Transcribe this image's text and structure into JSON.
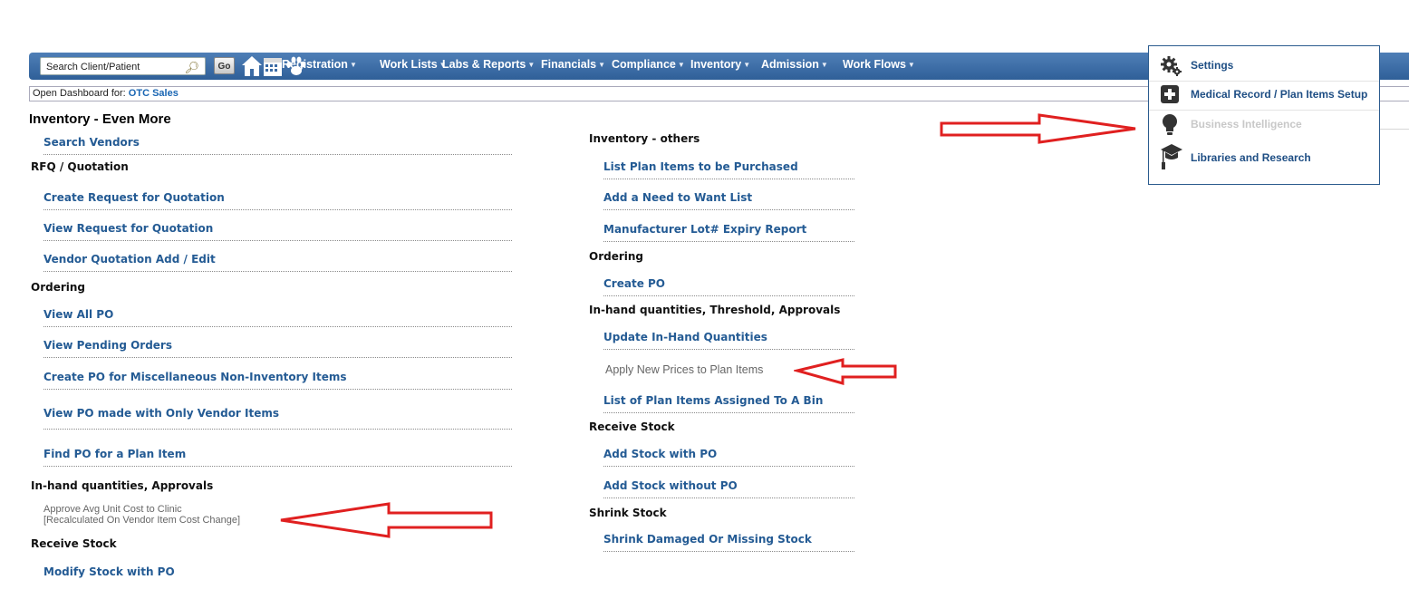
{
  "nav": {
    "search_placeholder": "Search Client/Patient",
    "go_label": "Go",
    "menus": [
      "Registration",
      "Work Lists",
      "Labs & Reports",
      "Financials",
      "Compliance",
      "Inventory",
      "Admission",
      "Work Flows"
    ]
  },
  "dashboard": {
    "prefix": "Open Dashboard for:",
    "link": "OTC Sales"
  },
  "page_title": "Inventory - Even More",
  "left_column": {
    "search_vendors": "Search Vendors",
    "rfq_header": "RFQ / Quotation",
    "create_rfq": "Create Request for Quotation",
    "view_rfq": "View Request for Quotation",
    "vendor_quote": "Vendor Quotation Add / Edit",
    "ordering_header": "Ordering",
    "view_all_po": "View All PO",
    "view_pending": "View Pending Orders",
    "create_po_misc": "Create PO for Miscellaneous Non-Inventory Items",
    "view_po_vendor": "View PO made with Only Vendor Items",
    "find_po": "Find PO for a Plan Item",
    "inhand_header": "In-hand quantities, Approvals",
    "approve_line1": "Approve Avg Unit Cost to Clinic",
    "approve_line2": "[Recalculated On Vendor Item Cost Change]",
    "receive_header": "Receive Stock",
    "modify_stock": "Modify Stock with PO"
  },
  "right_column": {
    "others_header": "Inventory - others",
    "list_plan_items": "List Plan Items to be Purchased",
    "add_need": "Add a Need to Want List",
    "mfr_lot": "Manufacturer Lot# Expiry Report",
    "ordering_header": "Ordering",
    "create_po": "Create PO",
    "inhand_header": "In-hand quantities, Threshold, Approvals",
    "update_inhand": "Update In-Hand Quantities",
    "apply_prices": "Apply New Prices to Plan Items",
    "list_bin": "List of Plan Items Assigned To A Bin",
    "receive_header": "Receive Stock",
    "add_stock_po": "Add Stock with PO",
    "add_stock_no_po": "Add Stock without PO",
    "shrink_header": "Shrink Stock",
    "shrink_damaged": "Shrink Damaged Or Missing Stock"
  },
  "popup": {
    "items": [
      {
        "label": "Settings",
        "icon": "gears-icon"
      },
      {
        "label": "Medical Record / Plan Items Setup",
        "icon": "medical-plus-icon"
      },
      {
        "label": "Business Intelligence",
        "icon": "lightbulb-icon"
      },
      {
        "label": "Libraries and Research",
        "icon": "graduation-cap-icon"
      }
    ]
  },
  "colors": {
    "nav_bar": "#3b6ba5",
    "link": "#245b94",
    "arrow": "#e02020"
  }
}
